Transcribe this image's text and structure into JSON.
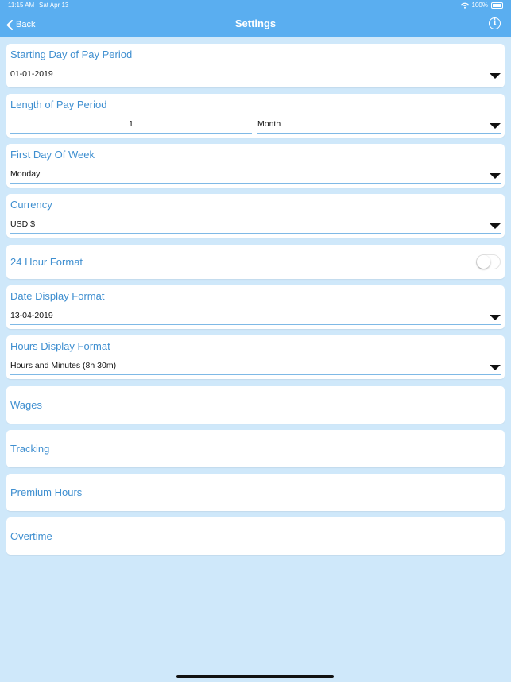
{
  "status_bar": {
    "time": "11:15 AM",
    "date": "Sat Apr 13",
    "battery": "100%"
  },
  "nav": {
    "back_label": "Back",
    "title": "Settings",
    "info_glyph": "i"
  },
  "settings": {
    "starting_day": {
      "label": "Starting Day of Pay Period",
      "value": "01-01-2019"
    },
    "length": {
      "label": "Length of Pay Period",
      "number": "1",
      "unit": "Month"
    },
    "first_day": {
      "label": "First Day Of Week",
      "value": "Monday"
    },
    "currency": {
      "label": "Currency",
      "value": "USD $"
    },
    "hour_format": {
      "label": "24 Hour Format",
      "enabled": false
    },
    "date_format": {
      "label": "Date Display Format",
      "value": "13-04-2019"
    },
    "hours_format": {
      "label": "Hours Display Format",
      "value": "Hours and Minutes (8h 30m)"
    },
    "wages": {
      "label": "Wages"
    },
    "tracking": {
      "label": "Tracking"
    },
    "premium": {
      "label": "Premium Hours"
    },
    "overtime": {
      "label": "Overtime"
    }
  }
}
